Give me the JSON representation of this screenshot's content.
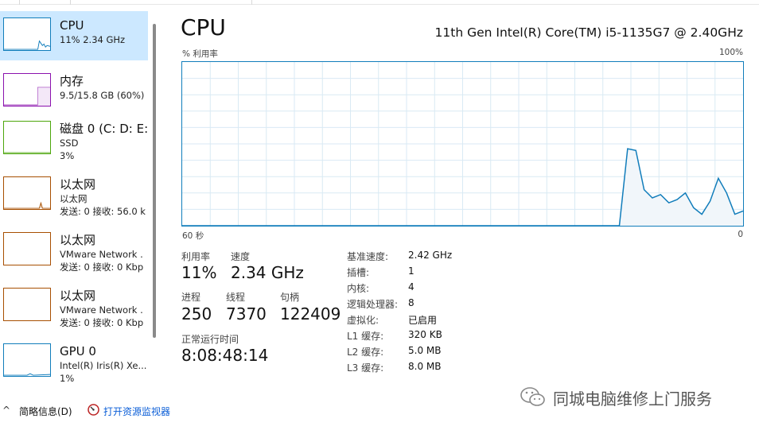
{
  "sidebar": {
    "items": [
      {
        "title": "CPU",
        "sub1": "11% 2.34 GHz",
        "sub2": "",
        "color": "#117dbb"
      },
      {
        "title": "内存",
        "sub1": "9.5/15.8 GB (60%)",
        "sub2": "",
        "color": "#8b12ae"
      },
      {
        "title": "磁盘 0 (C: D: E:",
        "sub1": "SSD",
        "sub2": "3%",
        "color": "#4da60c"
      },
      {
        "title": "以太网",
        "sub1": "以太网",
        "sub2": "发送: 0 接收: 56.0 k",
        "color": "#a74f01"
      },
      {
        "title": "以太网",
        "sub1": "VMware Network .",
        "sub2": "发送: 0 接收: 0 Kbp",
        "color": "#a74f01"
      },
      {
        "title": "以太网",
        "sub1": "VMware Network .",
        "sub2": "发送: 0 接收: 0 Kbp",
        "color": "#a74f01"
      },
      {
        "title": "GPU 0",
        "sub1": "Intel(R) Iris(R) Xe...",
        "sub2": "1%",
        "color": "#117dbb"
      }
    ]
  },
  "main": {
    "title": "CPU",
    "model": "11th Gen Intel(R) Core(TM) i5-1135G7 @ 2.40GHz",
    "graph": {
      "y_label": "% 利用率",
      "y_max_label": "100%",
      "x_left_label": "60 秒",
      "x_right_label": "0",
      "line_color": "#117dbb",
      "fill_color": "#f1f6fa",
      "grid_color": "#d9eaf4",
      "utilization_percent": [
        0,
        0,
        0,
        0,
        0,
        0,
        0,
        0,
        0,
        0,
        0,
        0,
        0,
        0,
        0,
        0,
        0,
        0,
        0,
        0,
        0,
        0,
        0,
        0,
        0,
        0,
        0,
        0,
        0,
        0,
        0,
        0,
        0,
        0,
        0,
        0,
        0,
        0,
        0,
        0,
        0,
        0,
        0,
        0,
        0,
        0,
        0,
        0,
        0,
        0,
        0,
        0,
        0,
        0,
        47,
        46,
        22,
        17,
        19,
        14,
        16,
        20,
        11,
        7,
        15,
        29,
        20,
        7,
        9
      ]
    },
    "stats": {
      "util_label": "利用率",
      "util_value": "11%",
      "speed_label": "速度",
      "speed_value": "2.34 GHz",
      "proc_label": "进程",
      "proc_value": "250",
      "thread_label": "线程",
      "thread_value": "7370",
      "handle_label": "句柄",
      "handle_value": "122409",
      "uptime_label": "正常运行时间",
      "uptime_value": "8:08:48:14"
    },
    "specs": [
      {
        "label": "基准速度:",
        "value": "2.42 GHz"
      },
      {
        "label": "插槽:",
        "value": "1"
      },
      {
        "label": "内核:",
        "value": "4"
      },
      {
        "label": "逻辑处理器:",
        "value": "8"
      },
      {
        "label": "虚拟化:",
        "value": "已启用"
      },
      {
        "label": "L1 缓存:",
        "value": "320 KB"
      },
      {
        "label": "L2 缓存:",
        "value": "5.0 MB"
      },
      {
        "label": "L3 缓存:",
        "value": "8.0 MB"
      }
    ]
  },
  "bottom": {
    "chevron": "^",
    "brief_label": "简略信息(D)",
    "resmon_label": "打开资源监视器"
  },
  "watermark": {
    "text": "同城电脑维修上门服务"
  }
}
